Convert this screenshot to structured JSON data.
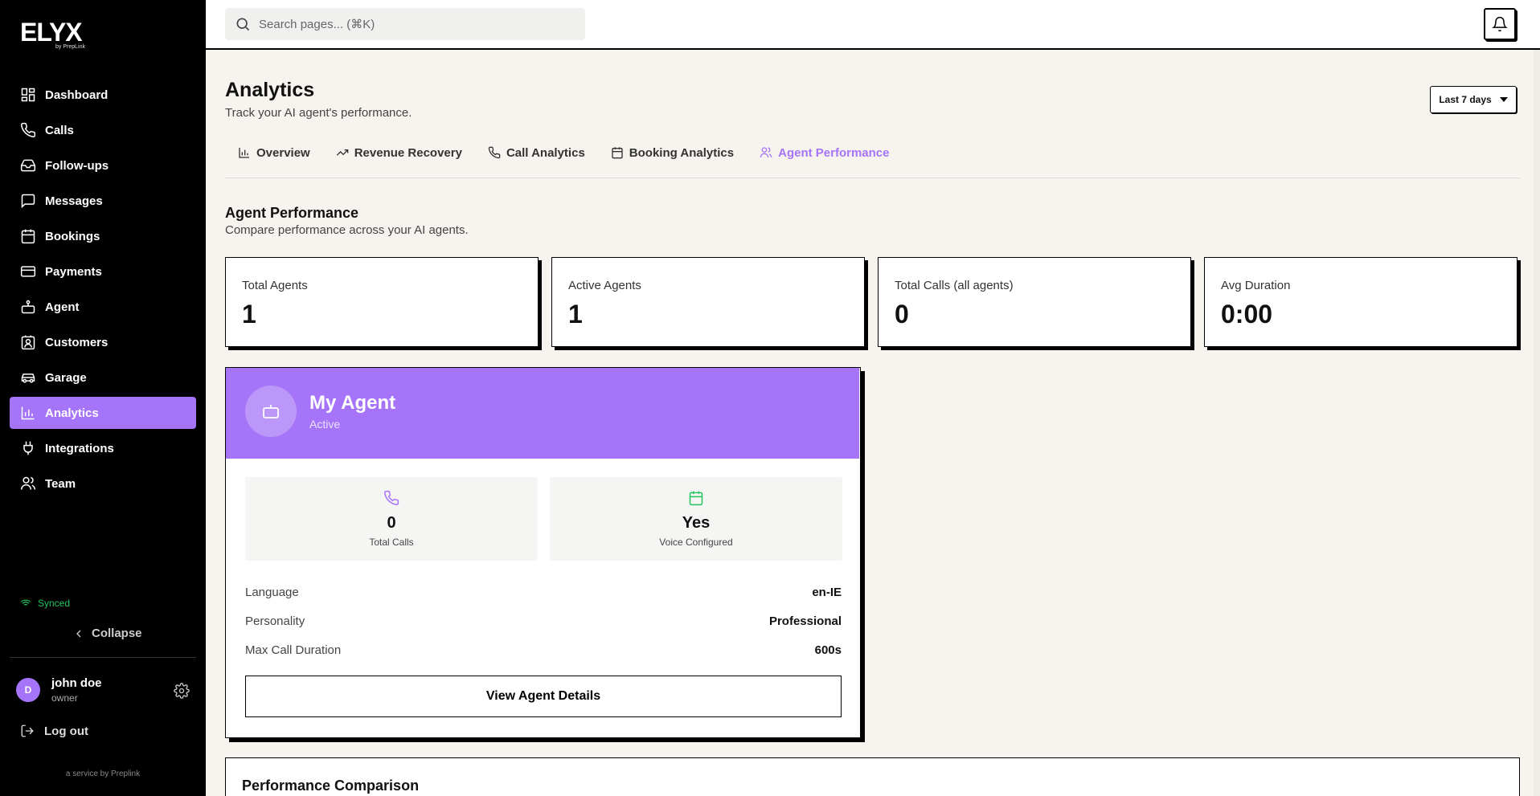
{
  "app": {
    "logo": "ELYX",
    "logo_sub": "by PrepLink",
    "service_note": "a service by Preplink"
  },
  "sidebar": {
    "items": [
      {
        "label": "Dashboard",
        "icon": "grid-icon"
      },
      {
        "label": "Calls",
        "icon": "phone-icon"
      },
      {
        "label": "Follow-ups",
        "icon": "inbox-icon"
      },
      {
        "label": "Messages",
        "icon": "message-icon"
      },
      {
        "label": "Bookings",
        "icon": "calendar-icon"
      },
      {
        "label": "Payments",
        "icon": "credit-card-icon"
      },
      {
        "label": "Agent",
        "icon": "bot-icon"
      },
      {
        "label": "Customers",
        "icon": "contact-icon"
      },
      {
        "label": "Garage",
        "icon": "car-icon"
      },
      {
        "label": "Analytics",
        "icon": "bar-chart-icon",
        "active": true
      },
      {
        "label": "Integrations",
        "icon": "plug-icon"
      },
      {
        "label": "Team",
        "icon": "users-icon"
      }
    ],
    "synced_label": "Synced",
    "collapse_label": "Collapse",
    "logout_label": "Log out",
    "accent_color": "#a674f8",
    "synced_color": "#22c55e"
  },
  "user": {
    "initial": "D",
    "name": "john doe",
    "role": "owner"
  },
  "topbar": {
    "search_placeholder": "Search pages... (⌘K)"
  },
  "page": {
    "title": "Analytics",
    "subtitle": "Track your AI agent's performance.",
    "date_range": "Last 7 days"
  },
  "tabs": [
    {
      "label": "Overview",
      "icon": "bar-chart-icon"
    },
    {
      "label": "Revenue Recovery",
      "icon": "trending-up-icon"
    },
    {
      "label": "Call Analytics",
      "icon": "phone-icon"
    },
    {
      "label": "Booking Analytics",
      "icon": "calendar-icon"
    },
    {
      "label": "Agent Performance",
      "icon": "users-icon",
      "active": true
    }
  ],
  "section": {
    "title": "Agent Performance",
    "subtitle": "Compare performance across your AI agents."
  },
  "stats": [
    {
      "label": "Total Agents",
      "value": "1"
    },
    {
      "label": "Active Agents",
      "value": "1"
    },
    {
      "label": "Total Calls (all agents)",
      "value": "0"
    },
    {
      "label": "Avg Duration",
      "value": "0:00"
    }
  ],
  "agent": {
    "name": "My Agent",
    "status": "Active",
    "metrics": [
      {
        "value": "0",
        "label": "Total Calls",
        "icon": "phone-icon"
      },
      {
        "value": "Yes",
        "label": "Voice Configured",
        "icon": "calendar-icon"
      }
    ],
    "details": [
      {
        "label": "Language",
        "value": "en-IE"
      },
      {
        "label": "Personality",
        "value": "Professional"
      },
      {
        "label": "Max Call Duration",
        "value": "600s"
      }
    ],
    "button_label": "View Agent Details"
  },
  "comparison": {
    "title": "Performance Comparison"
  }
}
